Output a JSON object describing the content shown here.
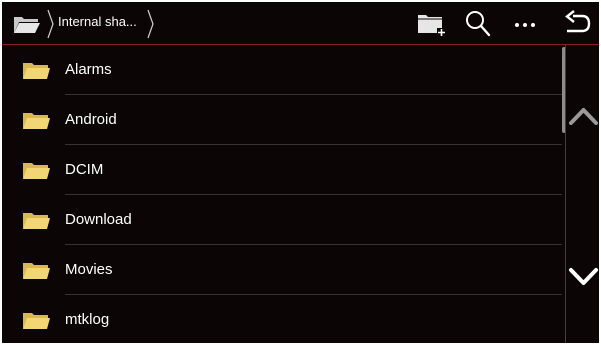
{
  "toolbar": {
    "breadcrumb_label": "Internal sha...",
    "icons": [
      "folder-open-icon",
      "new-folder-icon",
      "search-icon",
      "more-icon",
      "back-icon"
    ]
  },
  "folders": [
    {
      "name": "Alarms"
    },
    {
      "name": "Android"
    },
    {
      "name": "DCIM"
    },
    {
      "name": "Download"
    },
    {
      "name": "Movies"
    },
    {
      "name": "mtklog"
    }
  ],
  "side": {
    "icons": [
      "scroll-up-icon",
      "scroll-down-icon"
    ]
  },
  "colors": {
    "background": "#0b0505",
    "accent": "#8a1f25",
    "folder": "#f2d675",
    "text": "#ffffff"
  }
}
